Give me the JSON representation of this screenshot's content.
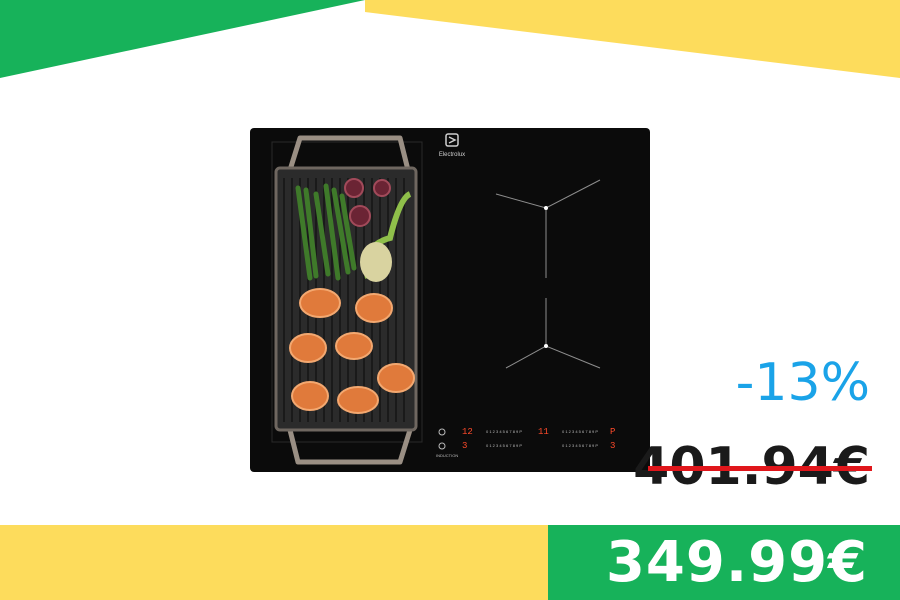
{
  "colors": {
    "green": "#17b25a",
    "yellow": "#fddc5c",
    "discount_blue": "#1aa3e8",
    "strike_red": "#e0161b",
    "cooktop_black": "#0b0b0b"
  },
  "product": {
    "brand": "Electrolux",
    "panel_label": "INDUCTION",
    "image_icon": "induction-cooktop-with-grill-plate"
  },
  "pricing": {
    "discount": "-13%",
    "old_price": "401.94€",
    "new_price": "349.99€"
  }
}
